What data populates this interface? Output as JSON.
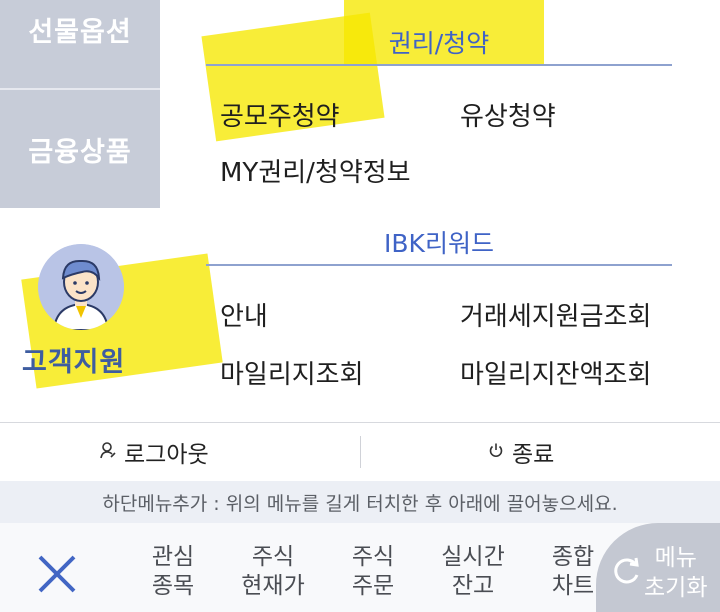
{
  "sidebar": {
    "items": [
      {
        "label": "선물옵션"
      },
      {
        "label": "금융상품"
      }
    ]
  },
  "support": {
    "label": "고객지원",
    "avatar_icon": "person-avatar-icon"
  },
  "sections": [
    {
      "title": "권리/청약",
      "items": [
        "공모주청약",
        "유상청약",
        "MY권리/청약정보"
      ]
    },
    {
      "title": "IBK리워드",
      "items": [
        "안내",
        "거래세지원금조회",
        "마일리지조회",
        "마일리지잔액조회"
      ]
    }
  ],
  "actions": {
    "logout_label": "로그아웃",
    "logout_icon": "person-icon",
    "exit_label": "종료",
    "exit_icon": "power-icon"
  },
  "hint": "하단메뉴추가 : 위의 메뉴를 길게 터치한 후 아래에 끌어놓으세요.",
  "bottom_bar": {
    "close_icon": "close-icon",
    "quick_menu": [
      {
        "line1": "관심",
        "line2": "종목"
      },
      {
        "line1": "주식",
        "line2": "현재가"
      },
      {
        "line1": "주식",
        "line2": "주문"
      },
      {
        "line1": "실시간",
        "line2": "잔고"
      },
      {
        "line1": "종합",
        "line2": "차트"
      }
    ],
    "reset": {
      "line1": "메뉴",
      "line2": "초기화",
      "icon": "refresh-icon"
    }
  },
  "colors": {
    "accent": "#3f63c6",
    "sidebar_bg": "#c7ccd8",
    "highlight": "#f6e800",
    "support_text": "#3e5da0"
  }
}
